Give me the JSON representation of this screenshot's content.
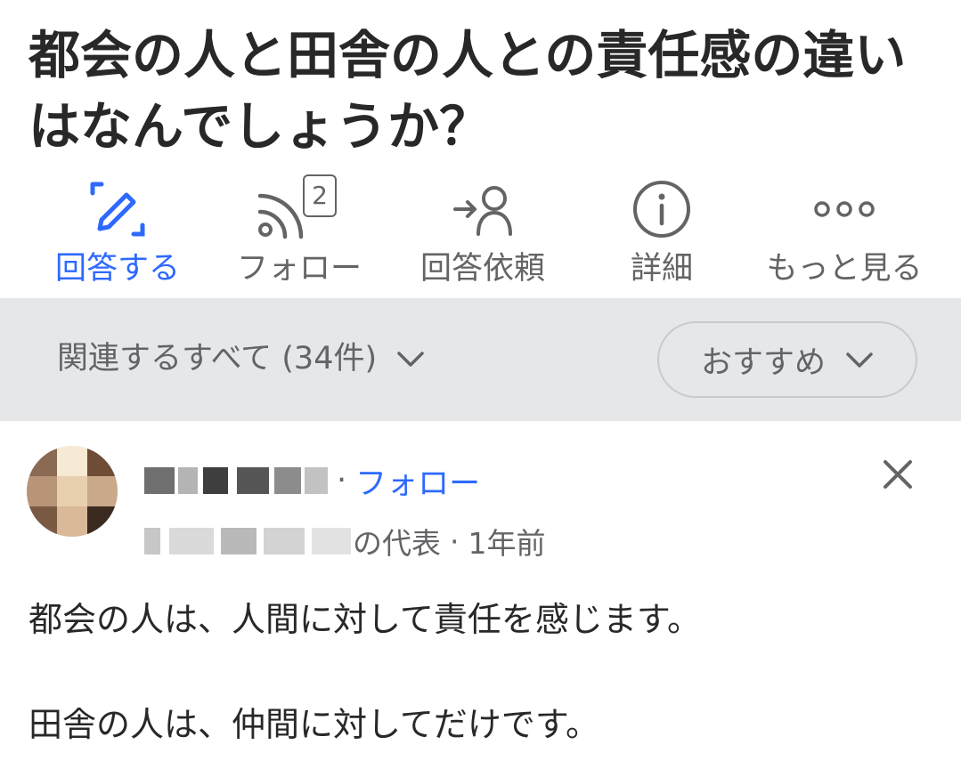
{
  "question": {
    "title": "都会の人と田舎の人との責任感の違いはなんでしょうか？"
  },
  "actions": [
    {
      "label": "回答する",
      "icon": "edit-pencil-icon",
      "active": true
    },
    {
      "label": "フォロー",
      "icon": "follow-feed-icon",
      "badge": "2"
    },
    {
      "label": "回答依頼",
      "icon": "request-answer-icon"
    },
    {
      "label": "詳細",
      "icon": "info-icon"
    },
    {
      "label": "もっと見る",
      "icon": "more-icon"
    }
  ],
  "filter": {
    "related_label": "関連するすべて (34件)",
    "sort_label": "おすすめ"
  },
  "answer": {
    "follow_label": "フォロー",
    "credential_suffix": "の代表",
    "time": "1年前",
    "paragraphs": [
      "都会の人は、人間に対して責任を感じます。",
      "田舎の人は、仲間に対してだけです。"
    ]
  },
  "colors": {
    "accent": "#2e69ff",
    "text": "#282829",
    "muted": "#636466",
    "filter_bg": "#e6e7e8"
  }
}
